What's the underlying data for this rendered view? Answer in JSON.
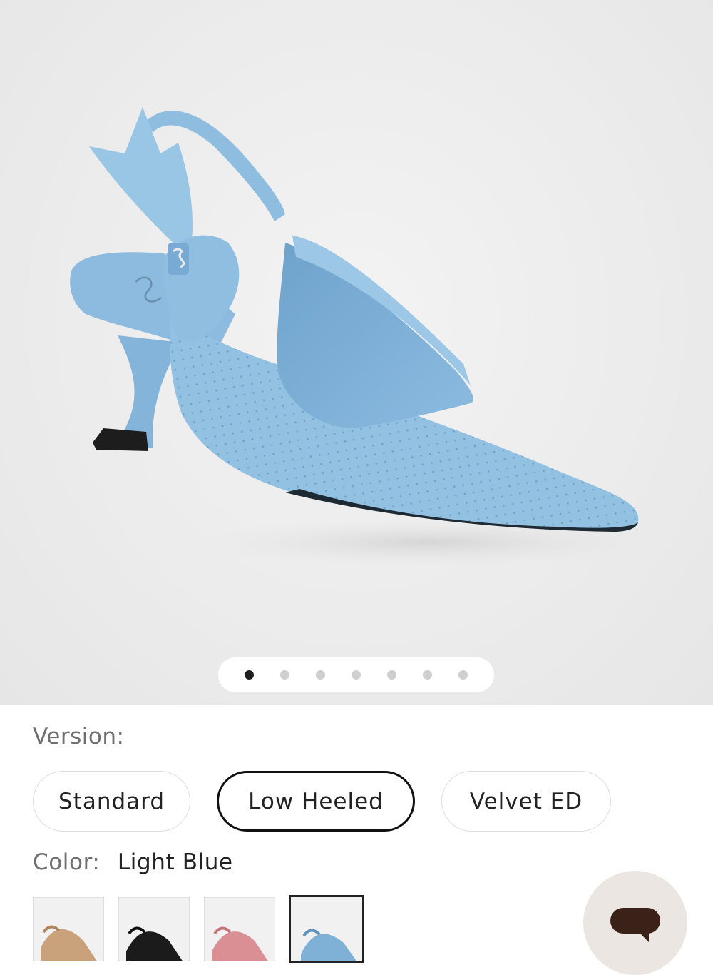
{
  "gallery": {
    "image_name": "light-blue-slingback-pump",
    "slide_count": 7,
    "active_index": 0
  },
  "version": {
    "label": "Version:",
    "options": [
      "Standard",
      "Low Heeled",
      "Velvet ED"
    ],
    "selected": "Low Heeled"
  },
  "color": {
    "label": "Color:",
    "value": "Light Blue",
    "swatches": [
      {
        "name": "nude",
        "color": "#c9a27c"
      },
      {
        "name": "black",
        "color": "#1b1b1b"
      },
      {
        "name": "pink",
        "color": "#d98f93"
      },
      {
        "name": "light-blue",
        "color": "#7fb0d6"
      }
    ],
    "selected_index": 3
  },
  "chat": {
    "icon": "chat-bubble-icon",
    "color": "#3a2218"
  },
  "colors": {
    "product_blue": "#8fbee0",
    "accent": "#111111"
  }
}
